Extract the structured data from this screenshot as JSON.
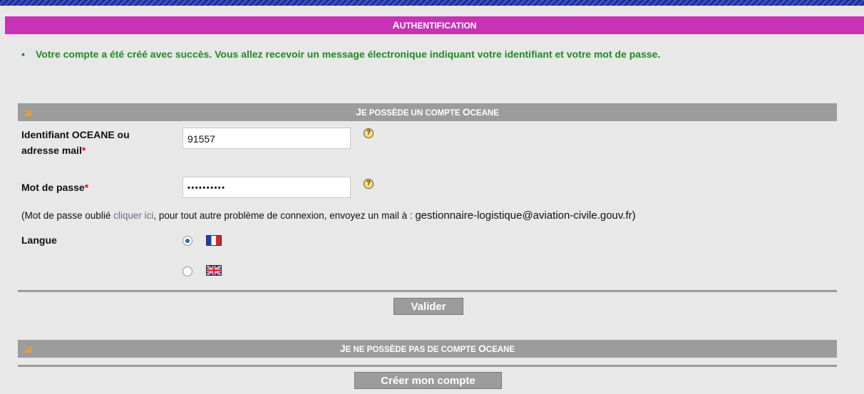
{
  "header": {
    "title_first": "A",
    "title_rest": "UTHENTIFICATION"
  },
  "success_message": "Votre compte a été créé avec succès. Vous allez recevoir un message électronique indiquant votre identifiant et votre mot de passe.",
  "section_existing": {
    "title_parts": [
      "J",
      "E POSSÈDE UN COMPTE ",
      "O",
      "CEANE"
    ]
  },
  "login": {
    "identifiant_label_line1": "Identifiant OCEANE ou",
    "identifiant_label_line2": "adresse mail",
    "identifiant_value": "91557",
    "password_label": "Mot de passe",
    "password_value": "••••••••••",
    "required_mark": "*",
    "help_glyph": "?"
  },
  "forgot": {
    "before_link": "(Mot de passe oublié ",
    "link_text": "cliquer ici",
    "after_link": ", pour tout autre problème de connexion, envoyez un mail à : ",
    "email": "gestionnaire-logistique@aviation-civile.gouv.fr",
    "close": ")"
  },
  "language": {
    "label": "Langue",
    "options": [
      {
        "code": "fr",
        "selected": true
      },
      {
        "code": "en",
        "selected": false
      }
    ]
  },
  "buttons": {
    "validate": "Valider",
    "create": "Créer mon compte"
  },
  "section_new": {
    "title_parts": [
      "J",
      "E NE POSSÈDE PAS DE COMPTE ",
      "O",
      "CEANE"
    ]
  },
  "colors": {
    "title_bar": "#c832b4",
    "section_bar": "#9c9c9c",
    "success_text": "#1f8a24",
    "background": "#e8e8e8",
    "arrow": "#f0a020"
  },
  "icons": {
    "section_arrow": "arrow-down-right-icon",
    "help": "help-icon",
    "flag_fr": "flag-fr-icon",
    "flag_uk": "flag-uk-icon"
  }
}
